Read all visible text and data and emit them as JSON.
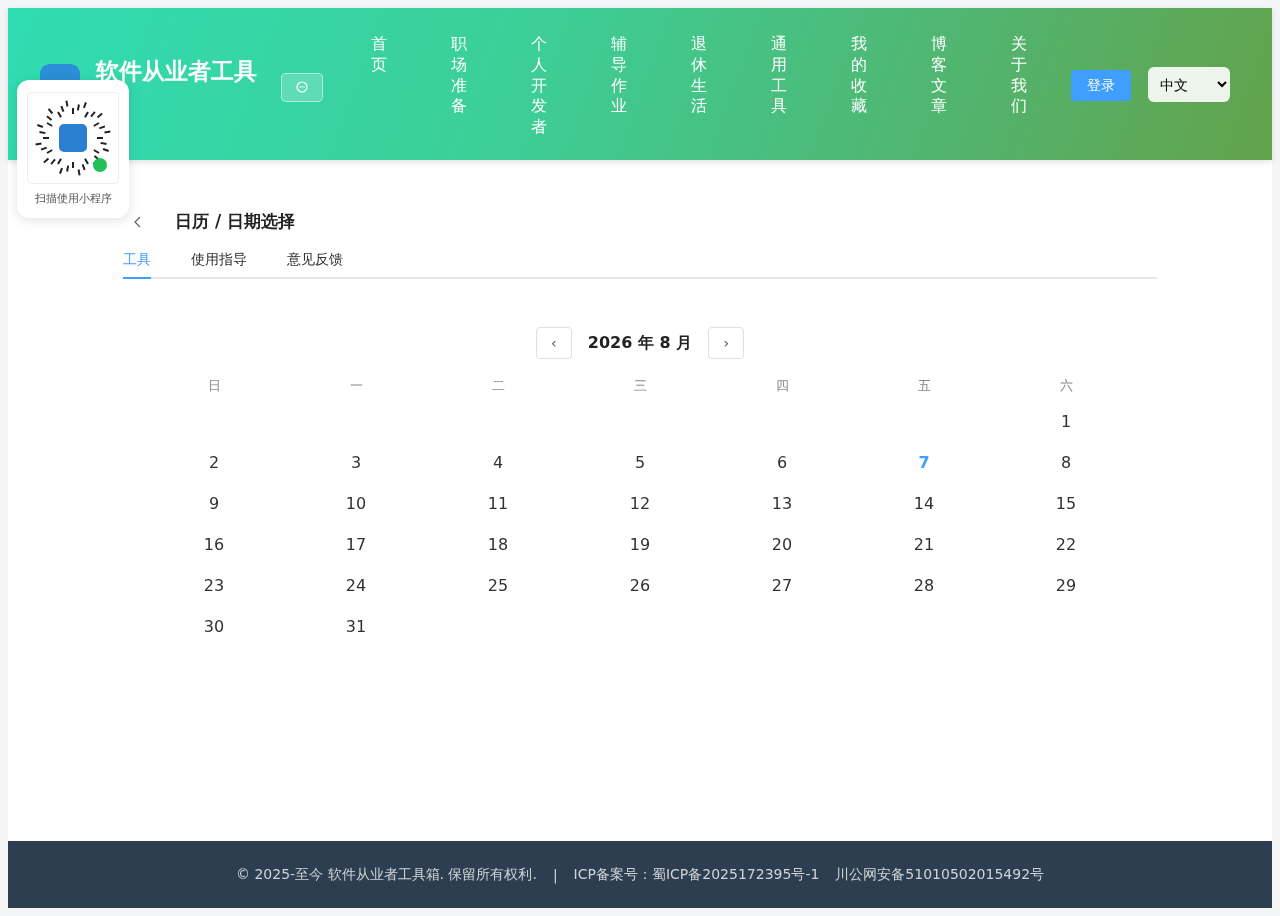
{
  "header": {
    "brand": "软件从业者工具",
    "nav": [
      {
        "label": "首页"
      },
      {
        "label": "职场准备"
      },
      {
        "label": "个人开发者"
      },
      {
        "label": "辅导作业"
      },
      {
        "label": "退休生活"
      },
      {
        "label": "通用工具"
      },
      {
        "label": "我的收藏"
      },
      {
        "label": "博客文章"
      },
      {
        "label": "关于我们"
      }
    ],
    "login": "登录",
    "language": "中文"
  },
  "qr_popup": {
    "caption": "扫描使用小程序"
  },
  "page": {
    "title": "日历 / 日期选择",
    "tabs": [
      {
        "label": "工具",
        "selected": true
      },
      {
        "label": "使用指导",
        "selected": false
      },
      {
        "label": "意见反馈",
        "selected": false
      }
    ]
  },
  "calendar": {
    "prev": "‹",
    "month": "2026 年 8 月",
    "next": "›",
    "weekdays": [
      "日",
      "一",
      "二",
      "三",
      "四",
      "五",
      "六"
    ],
    "weeks": [
      [
        {
          "kind": "blank"
        },
        {
          "kind": "blank"
        },
        {
          "kind": "blank"
        },
        {
          "kind": "blank"
        },
        {
          "kind": "blank"
        },
        {
          "kind": "blank"
        },
        {
          "kind": "day",
          "day": "1",
          "selected": false
        }
      ],
      [
        {
          "day": "2",
          "selected": false
        },
        {
          "day": "3",
          "selected": false
        },
        {
          "day": "4",
          "selected": false
        },
        {
          "day": "5",
          "selected": false
        },
        {
          "day": "6",
          "selected": false
        },
        {
          "day": "7",
          "selected": true
        },
        {
          "day": "8",
          "selected": false
        }
      ],
      [
        {
          "day": "9",
          "selected": false
        },
        {
          "day": "10",
          "selected": false
        },
        {
          "day": "11",
          "selected": false
        },
        {
          "day": "12",
          "selected": false
        },
        {
          "day": "13",
          "selected": false
        },
        {
          "day": "14",
          "selected": false
        },
        {
          "day": "15",
          "selected": false
        }
      ],
      [
        {
          "day": "16",
          "selected": false
        },
        {
          "day": "17",
          "selected": false
        },
        {
          "day": "18",
          "selected": false
        },
        {
          "day": "19",
          "selected": false
        },
        {
          "day": "20",
          "selected": false
        },
        {
          "day": "21",
          "selected": false
        },
        {
          "day": "22",
          "selected": false
        }
      ],
      [
        {
          "day": "23",
          "selected": false
        },
        {
          "day": "24",
          "selected": false
        },
        {
          "day": "25",
          "selected": false
        },
        {
          "day": "26",
          "selected": false
        },
        {
          "day": "27",
          "selected": false
        },
        {
          "day": "28",
          "selected": false
        },
        {
          "day": "29",
          "selected": false
        }
      ],
      [
        {
          "day": "30",
          "selected": false
        },
        {
          "day": "31",
          "selected": false
        },
        {
          "kind": "blank"
        },
        {
          "kind": "blank"
        },
        {
          "kind": "blank"
        },
        {
          "kind": "blank"
        },
        {
          "kind": "blank"
        }
      ]
    ]
  },
  "footer": {
    "copyright": "© 2025-至今 软件从业者工具箱. 保留所有权利.",
    "separator": "|",
    "icp": "ICP备案号：蜀ICP备2025172395号-1",
    "police": "川公网安备51010502015492号"
  }
}
